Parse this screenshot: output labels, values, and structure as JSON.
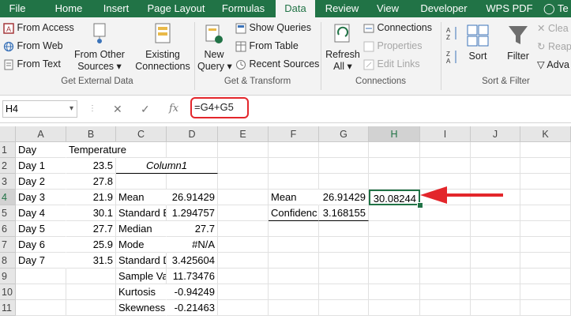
{
  "tabs": [
    "File",
    "Home",
    "Insert",
    "Page Layout",
    "Formulas",
    "Data",
    "Review",
    "View",
    "Developer",
    "WPS PDF",
    "Te"
  ],
  "active_tab": 5,
  "ribbon": {
    "from_access": "From Access",
    "from_web": "From Web",
    "from_text": "From Text",
    "from_other_1": "From Other",
    "from_other_2": "Sources",
    "existing_1": "Existing",
    "existing_2": "Connections",
    "group_external": "Get External Data",
    "new_query_1": "New",
    "new_query_2": "Query",
    "show_queries": "Show Queries",
    "from_table": "From Table",
    "recent_sources": "Recent Sources",
    "group_transform": "Get & Transform",
    "refresh_1": "Refresh",
    "refresh_2": "All",
    "connections": "Connections",
    "properties": "Properties",
    "edit_links": "Edit Links",
    "group_connections": "Connections",
    "sort": "Sort",
    "filter": "Filter",
    "clear": "Clea",
    "reapply": "Reap",
    "advanced": "Adva",
    "group_sort": "Sort & Filter"
  },
  "name_box": "H4",
  "formula": "=G4+G5",
  "columns": [
    "A",
    "B",
    "C",
    "D",
    "E",
    "F",
    "G",
    "H",
    "I",
    "J",
    "K"
  ],
  "rows": [
    "1",
    "2",
    "3",
    "4",
    "5",
    "6",
    "7",
    "8",
    "9",
    "10",
    "11"
  ],
  "selected_col": "H",
  "selected_row": "4",
  "cells": {
    "A1": "Day",
    "B1": "Temperature",
    "A2": "Day 1",
    "B2": "23.5",
    "C2": "Column1",
    "A3": "Day 2",
    "B3": "27.8",
    "A4": "Day 3",
    "B4": "21.9",
    "C4": "Mean",
    "D4": "26.91429",
    "F4": "Mean",
    "G4": "26.91429",
    "H4": "30.08244",
    "A5": "Day 4",
    "B5": "30.1",
    "C5": "Standard E",
    "D5": "1.294757",
    "F5": "Confidenc",
    "G5": "3.168155",
    "A6": "Day 5",
    "B6": "27.7",
    "C6": "Median",
    "D6": "27.7",
    "A7": "Day 6",
    "B7": "25.9",
    "C7": "Mode",
    "D7": "#N/A",
    "A8": "Day 7",
    "B8": "31.5",
    "C8": "Standard D",
    "D8": "3.425604",
    "C9": "Sample Va",
    "D9": "11.73476",
    "C10": "Kurtosis",
    "D10": "-0.94249",
    "C11": "Skewness",
    "D11": "-0.21463"
  },
  "colors": {
    "accent": "#217346",
    "highlight": "#e3262b"
  }
}
